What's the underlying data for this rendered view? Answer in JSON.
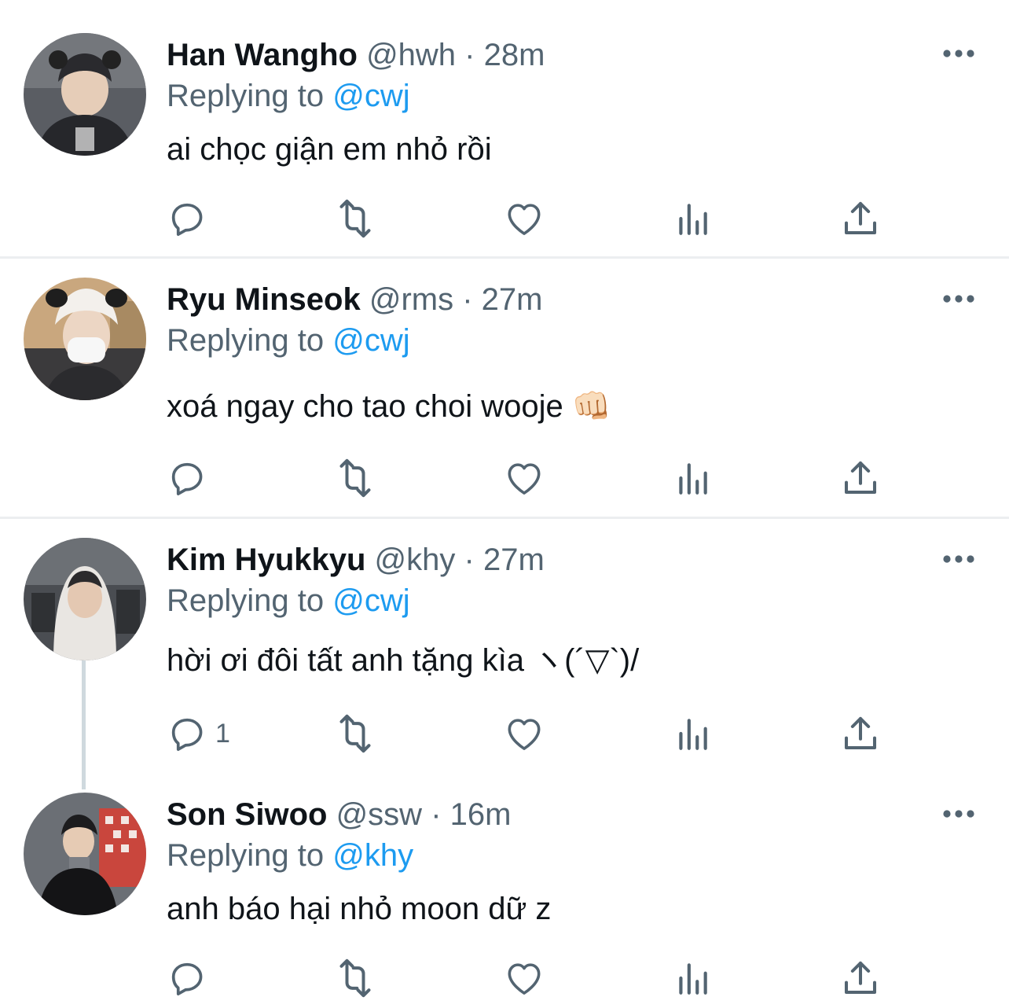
{
  "tweets": [
    {
      "name": "Han Wangho",
      "handle": "@hwh",
      "separator": "·",
      "time": "28m",
      "replying_prefix": "Replying to",
      "replying_to": "@cwj",
      "text": "ai chọc giận em nhỏ rồi",
      "reply_count": ""
    },
    {
      "name": "Ryu Minseok",
      "handle": "@rms",
      "separator": "·",
      "time": "27m",
      "replying_prefix": "Replying to",
      "replying_to": "@cwj",
      "text": "xoá ngay cho tao choi wooje 👊🏻",
      "reply_count": ""
    },
    {
      "name": "Kim Hyukkyu",
      "handle": "@khy",
      "separator": "·",
      "time": "27m",
      "replying_prefix": "Replying to",
      "replying_to": "@cwj",
      "text": "hời ơi đôi tất anh tặng kìa ヽ(´▽`)/",
      "reply_count": "1"
    },
    {
      "name": "Son Siwoo",
      "handle": "@ssw",
      "separator": "·",
      "time": "16m",
      "replying_prefix": "Replying to",
      "replying_to": "@khy",
      "text": "anh báo hại nhỏ moon dữ z",
      "reply_count": ""
    }
  ],
  "icons": {
    "reply": "speech-bubble-icon",
    "retweet": "retweet-arrows-icon",
    "like": "heart-outline-icon",
    "analytics": "bar-chart-icon",
    "share": "upload-arrow-icon",
    "more": "more-dots-icon"
  },
  "colors": {
    "text": "#0f1419",
    "secondary": "#536471",
    "link": "#1d9bf0",
    "divider": "#eceef0",
    "thread_line": "#cfd9de"
  }
}
